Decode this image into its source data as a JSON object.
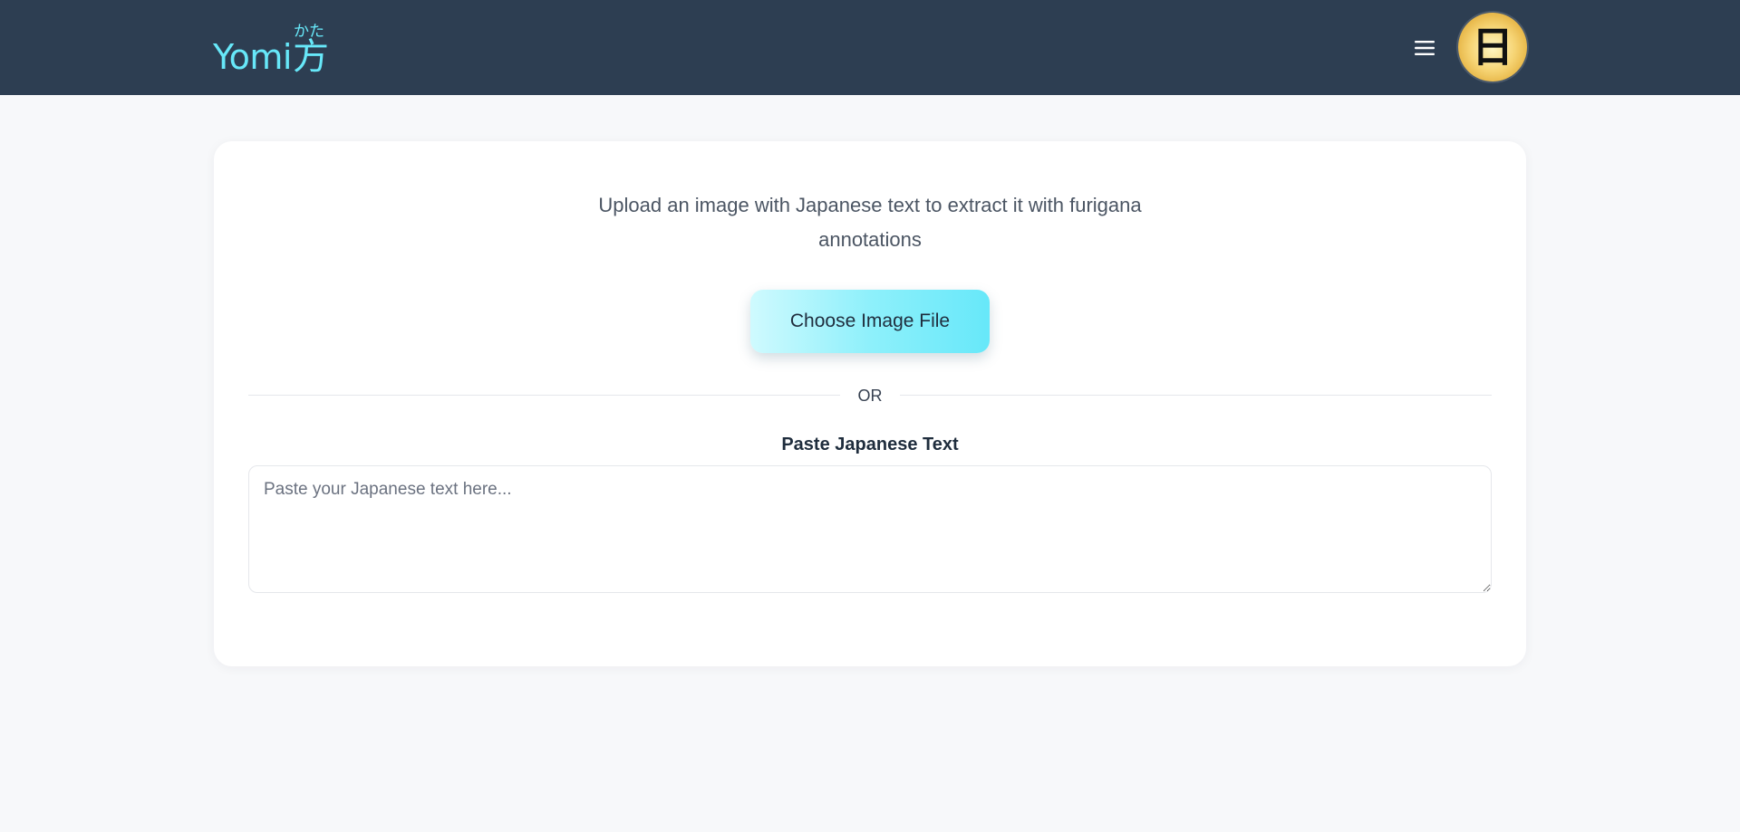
{
  "header": {
    "logo_text": "Yomi",
    "logo_kanji": "方",
    "logo_furigana": "かた",
    "menu_icon": "hamburger-menu-icon",
    "avatar_glyph": "日",
    "colors": {
      "background": "#2d3e52",
      "accent": "#67e8f9"
    }
  },
  "main": {
    "intro_text": "Upload an image with Japanese text to extract it with furigana annotations",
    "choose_button_label": "Choose Image File",
    "divider_text": "OR",
    "paste_label": "Paste Japanese Text",
    "paste_placeholder": "Paste your Japanese text here...",
    "paste_value": ""
  },
  "colors": {
    "page_background": "#f7f8fa",
    "card_background": "#ffffff",
    "button_gradient_start": "#cffafe",
    "button_gradient_end": "#67e8f9"
  }
}
